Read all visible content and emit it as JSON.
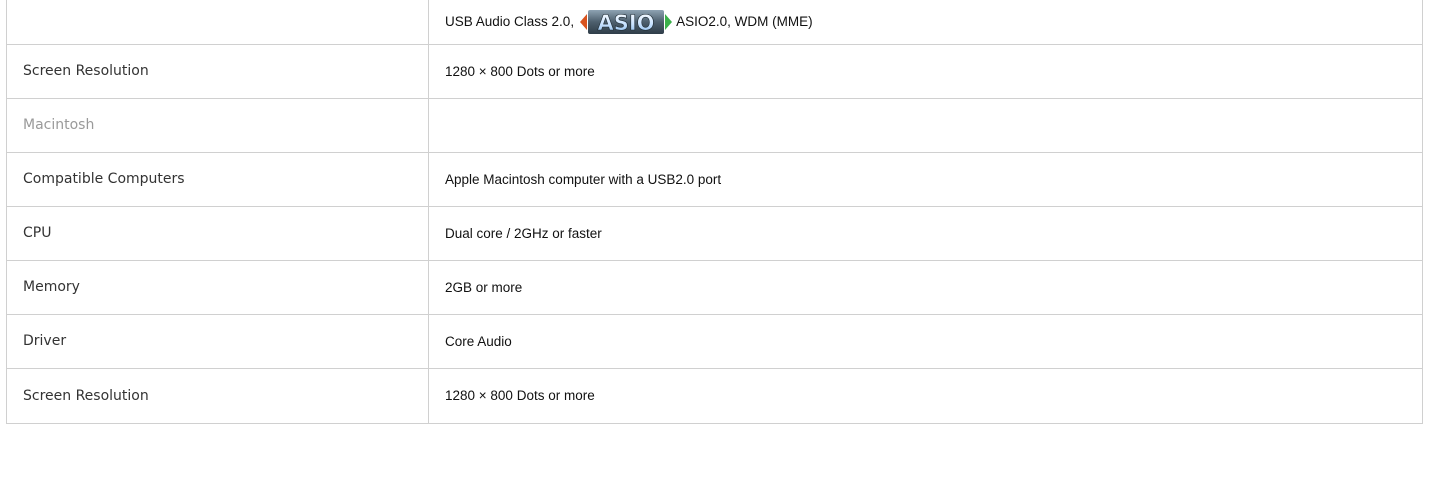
{
  "rows": [
    {
      "label": "",
      "value_prefix": "USB Audio Class 2.0,",
      "value_logo": "ASIO",
      "value_suffix": "ASIO2.0, WDM (MME)"
    },
    {
      "label": "Screen Resolution",
      "value": "1280 × 800 Dots or more"
    },
    {
      "label": "Macintosh",
      "value": ""
    },
    {
      "label": "Compatible Computers",
      "value": "Apple Macintosh computer with a USB2.0 port"
    },
    {
      "label": "CPU",
      "value": "Dual core / 2GHz or faster"
    },
    {
      "label": "Memory",
      "value": "2GB or more"
    },
    {
      "label": "Driver",
      "value": "Core Audio"
    },
    {
      "label": "Screen Resolution",
      "value": "1280 × 800 Dots or more"
    }
  ],
  "colors": {
    "border": "#d0d0d0",
    "section_label": "#9a9a9a",
    "asio_bg": "#5a6b78",
    "asio_text": "#e6f2ff",
    "asio_left_arrow": "#d9531e",
    "asio_right_arrow": "#3ab04a"
  }
}
